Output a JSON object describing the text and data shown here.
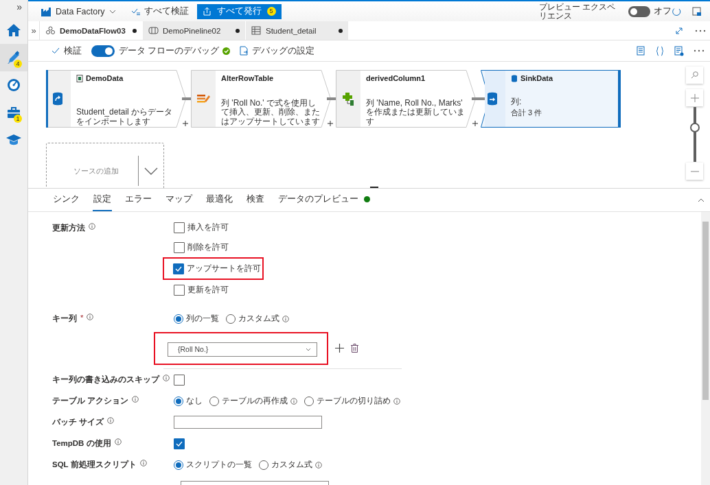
{
  "sidebar": {
    "expand": "»",
    "items": [
      {
        "kind": "home",
        "selected": false
      },
      {
        "kind": "author",
        "selected": true,
        "badge": "4"
      },
      {
        "kind": "monitor",
        "selected": false
      },
      {
        "kind": "manage",
        "selected": false,
        "badge": "1"
      },
      {
        "kind": "learn",
        "selected": false
      }
    ]
  },
  "top_bar": {
    "factory": "Data Factory",
    "validate_all": "すべて検証",
    "publish_all": {
      "label": "すべて発行",
      "badge": "5"
    },
    "preview": {
      "label": "プレビュー エクスペリエンス",
      "on": false,
      "state_label": "オフ"
    }
  },
  "doc_tabs": {
    "expand": "»",
    "tabs": [
      {
        "kind": "dataflow",
        "label": "DemoDataFlow03",
        "selected": true,
        "unsaved": true
      },
      {
        "kind": "pipeline",
        "label": "DemoPineline02",
        "selected": false,
        "unsaved": true
      },
      {
        "kind": "table",
        "label": "Student_detail",
        "selected": false,
        "unsaved": true
      }
    ]
  },
  "toolbar": {
    "validate": "検証",
    "debug": {
      "label": "データ フローのデバッグ",
      "on": true,
      "ready": true
    },
    "debug_settings": "デバッグの設定"
  },
  "canvas": {
    "nodes": [
      {
        "kind": "source",
        "title": "DemoData",
        "description": "Student_detail からデータをインポートします",
        "selected": false
      },
      {
        "kind": "alter_row",
        "title": "AlterRowTable",
        "description": "列 'Roll No.' で式を使用して挿入、更新、削除、またはアップサートしています",
        "selected": false
      },
      {
        "kind": "derived",
        "title": "derivedColumn1",
        "description": "列 'Name, Roll No., Marks' を作成または更新しています",
        "selected": false
      },
      {
        "kind": "sink",
        "title": "SinkData",
        "description": "列:",
        "summary": "合計 3 件",
        "selected": true
      }
    ],
    "add_source": "ソースの追加",
    "zoom": {
      "level": 0.65
    }
  },
  "panel": {
    "tabs": [
      {
        "label": "シンク",
        "selected": false
      },
      {
        "label": "設定",
        "selected": true
      },
      {
        "label": "エラー",
        "selected": false
      },
      {
        "label": "マップ",
        "selected": false
      },
      {
        "label": "最適化",
        "selected": false
      },
      {
        "label": "検査",
        "selected": false
      },
      {
        "label": "データのプレビュー",
        "selected": false,
        "ready": true
      }
    ],
    "settings": [
      {
        "kind": "checkboxes",
        "label": "更新方法",
        "info": true,
        "options": [
          {
            "label": "挿入を許可",
            "checked": false,
            "highlighted": false
          },
          {
            "label": "削除を許可",
            "checked": false,
            "highlighted": false
          },
          {
            "label": "アップサートを許可",
            "checked": true,
            "highlighted": true
          },
          {
            "label": "更新を許可",
            "checked": false,
            "highlighted": false
          }
        ]
      },
      {
        "kind": "radios",
        "label": "キー列",
        "required": "*",
        "info": true,
        "options": [
          {
            "label": "列の一覧",
            "selected": true,
            "info": false
          },
          {
            "label": "カスタム式",
            "selected": false,
            "info": true
          }
        ]
      },
      {
        "kind": "select",
        "value": "{Roll No.}",
        "highlighted": true
      },
      {
        "kind": "checkbox",
        "label": "キー列の書き込みのスキップ",
        "info": true,
        "checked": false
      },
      {
        "kind": "radios",
        "label": "テーブル アクション",
        "info": true,
        "options": [
          {
            "label": "なし",
            "selected": true,
            "info": false
          },
          {
            "label": "テーブルの再作成",
            "selected": false,
            "info": true
          },
          {
            "label": "テーブルの切り詰め",
            "selected": false,
            "info": true
          }
        ]
      },
      {
        "kind": "input",
        "label": "バッチ サイズ",
        "info": true
      },
      {
        "kind": "checkbox",
        "label": "TempDB の使用",
        "info": true,
        "checked": true
      },
      {
        "kind": "radios",
        "label": "SQL 前処理スクリプト",
        "info": true,
        "options": [
          {
            "label": "スクリプトの一覧",
            "selected": true,
            "info": false
          },
          {
            "label": "カスタム式",
            "selected": false,
            "info": true
          }
        ]
      },
      {
        "kind": "input",
        "info": false
      }
    ]
  }
}
